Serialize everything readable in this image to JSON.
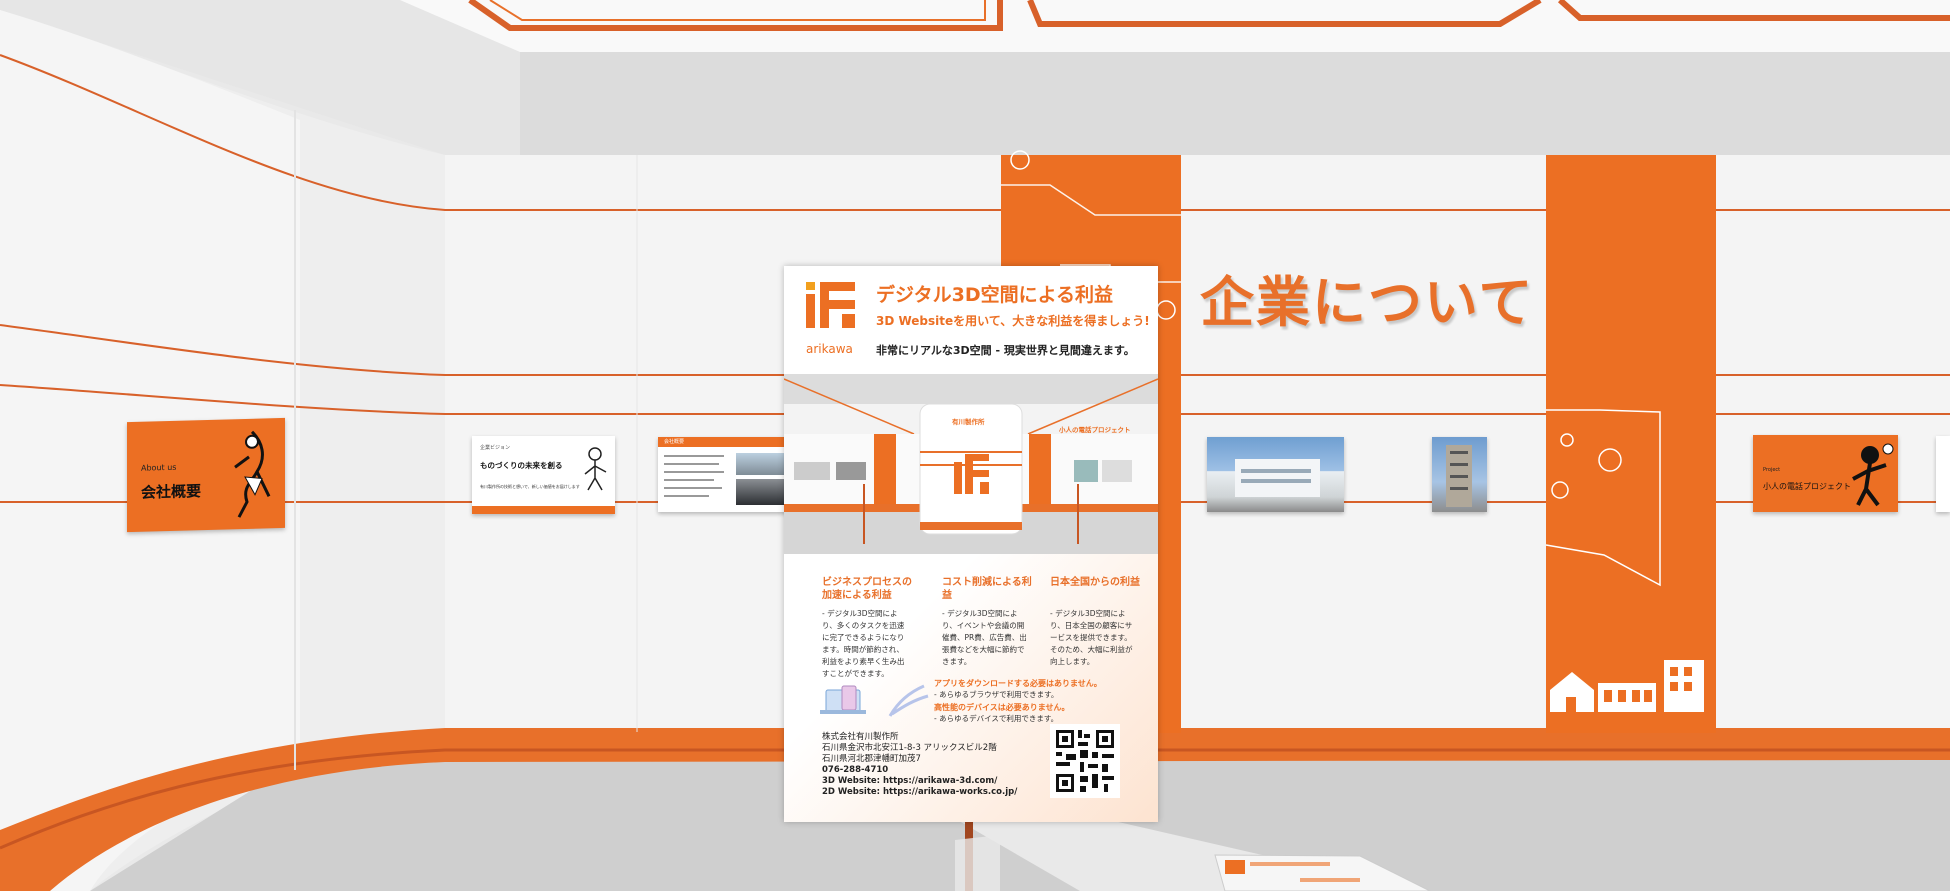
{
  "scene": {
    "wall_heading": "企業について",
    "colors": {
      "accent": "#e8702a",
      "accent_dark": "#c85622",
      "wall": "#f3f3f3",
      "floor": "#cfcfcf"
    }
  },
  "panels": {
    "company_overview": {
      "subtitle": "About us",
      "title": "会社概要"
    },
    "vision": {
      "subtitle": "企業ビジョン",
      "title": "ものづくりの未来を創る",
      "body": "有川製作所の技術と想いで、新しい価値をお届けします"
    },
    "history": {
      "header": "会社概要"
    },
    "project": {
      "subtitle": "Project",
      "title": "小人の電話プロジェクト"
    }
  },
  "poster": {
    "logo_text": "arikawa",
    "title": "デジタル3D空間による利益",
    "subtitle": "3D Websiteを用いて、大きな利益を得ましょう!",
    "tagline": "非常にリアルな3D空間 - 現実世界と見間違えます。",
    "preview": {
      "left_label": "有川製作所",
      "right_label": "小人の電話プロジェクト"
    },
    "benefits": [
      {
        "title": "ビジネスプロセスの加速による利益",
        "body": "- デジタル3D空間により、多くのタスクを迅速に完了できるようになります。時間が節約され、利益をより素早く生み出すことができます。"
      },
      {
        "title": "コスト削減による利益",
        "body": "- デジタル3D空間により、イベントや会議の開催費、PR費、広告費、出張費などを大幅に節約できます。"
      },
      {
        "title": "日本全国からの利益",
        "body": "- デジタル3D空間により、日本全国の顧客にサービスを提供できます。そのため、大幅に利益が向上します。"
      }
    ],
    "notes": [
      {
        "title": "アプリをダウンロードする必要はありません。",
        "body": "- あらゆるブラウザで利用できます。"
      },
      {
        "title": "高性能のデバイスは必要ありません。",
        "body": "- あらゆるデバイスで利用できます。"
      }
    ],
    "contact": [
      "株式会社有川製作所",
      "石川県金沢市北安江1-8-3 アリックスビル2階",
      "石川県河北郡津幡町加茂7",
      "076-288-4710",
      "3D Website: https://arikawa-3d.com/",
      "2D Website: https://arikawa-works.co.jp/"
    ]
  }
}
